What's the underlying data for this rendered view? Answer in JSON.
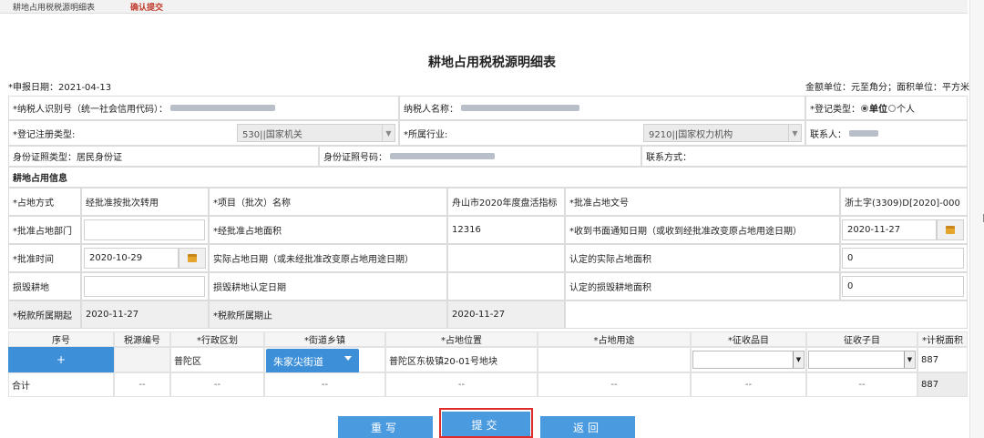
{
  "nav": {
    "tab1": "耕地占用税税源明细表",
    "tab2": "确认提交"
  },
  "page": {
    "title": "耕地占用税税源明细表",
    "report_date": "*申报日期：2021-04-13",
    "units": "金额单位：元至角分；面积单位：平方米"
  },
  "taxpayer": {
    "id_label": "*纳税人识别号（统一社会信用代码）：",
    "name_label": "纳税人名称：",
    "reg_type_label": "*登记类型：",
    "reg_type_opt1": "单位",
    "reg_type_opt2": "个人",
    "reg_auth_label": "*登记注册类型:",
    "reg_auth_value": "530||国家机关",
    "industry_label": "*所属行业:",
    "industry_value": "9210||国家权力机构",
    "contact_label": "联系人：",
    "id_type": "身份证照类型：居民身份证",
    "id_no_label": "身份证照号码：",
    "contact_method": "联系方式："
  },
  "section_title": "耕地占用信息",
  "occupation": {
    "method_label": "*占地方式",
    "method_value": "经批准按批次转用",
    "project_label": "*项目（批次）名称",
    "project_value": "舟山市2020年度盘活指标",
    "approval_doc_label": "*批准占地文号",
    "approval_doc_value": "浙土字(3309)D[2020]-000",
    "dept_label": "*批准占地部门",
    "approved_area_label": "*经批准占地面积",
    "approved_area_value": "12316",
    "notice_date_label": "*收到书面通知日期（或收到经批准改变原占地用途日期）",
    "notice_date_value": "2020-11-27",
    "approval_time_label": "*批准时间",
    "approval_time_value": "2020-10-29",
    "actual_date_label": "实际占地日期（或未经批准改变原占地用途日期）",
    "confirmed_area_label": "认定的实际占地面积",
    "confirmed_area_value": "0",
    "damaged_label": "损毁耕地",
    "damaged_date_label": "损毁耕地认定日期",
    "damaged_area_label": "认定的损毁耕地面积",
    "damaged_area_value": "0",
    "period_start_label": "*税款所属期起",
    "period_start_value": "2020-11-27",
    "period_end_label": "*税款所属期止",
    "period_end_value": "2020-11-27"
  },
  "table": {
    "headers": [
      "序号",
      "税源编号",
      "*行政区划",
      "*街道乡镇",
      "*占地位置",
      "*占地用途",
      "*征收品目",
      "征收子目",
      "*计税面积"
    ],
    "row": {
      "plus": "+",
      "district": "普陀区",
      "street": "朱家尖街道",
      "location": "普陀区东极镇20-01号地块",
      "area": "887"
    },
    "total": {
      "label": "合计",
      "dash": "--",
      "area": "887"
    }
  },
  "buttons": {
    "rewrite": "重写",
    "submit": "提交",
    "back": "返回"
  }
}
